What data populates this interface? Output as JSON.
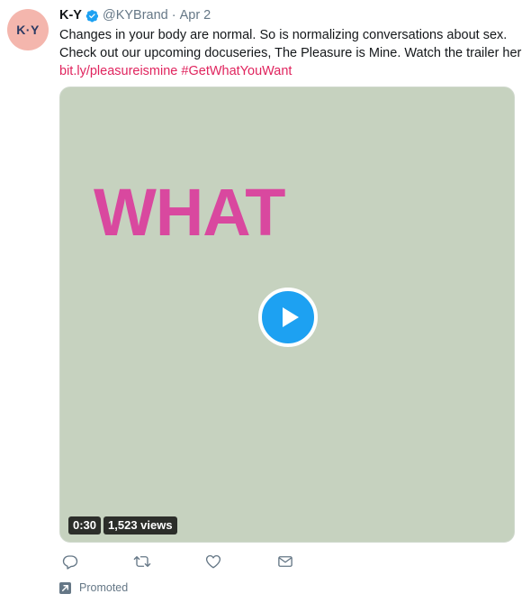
{
  "tweet": {
    "avatar_text": "K·Y",
    "name": "K-Y",
    "handle": "@KYBrand",
    "separator": "·",
    "date": "Apr 2",
    "text_lines": [
      "Changes in your body are normal. So is normalizing conversations about sex.",
      "Check out our upcoming docuseries, The Pleasure is Mine. Watch the trailer here"
    ],
    "link": "bit.ly/pleasureismine",
    "hashtag": "#GetWhatYouWant"
  },
  "media": {
    "overlay_word": "WHAT",
    "duration": "0:30",
    "views": "1,523 views",
    "background_color": "#c6d2bf",
    "word_color": "#d9489f",
    "play_color": "#1da1f2"
  },
  "actions": {
    "reply_icon": "reply-icon",
    "retweet_icon": "retweet-icon",
    "like_icon": "heart-icon",
    "dm_icon": "envelope-icon"
  },
  "footer": {
    "promoted_label": "Promoted",
    "promoted_icon": "promoted-arrow-icon"
  },
  "colors": {
    "link": "#e0245e",
    "muted": "#657786",
    "verified": "#1da1f2"
  }
}
